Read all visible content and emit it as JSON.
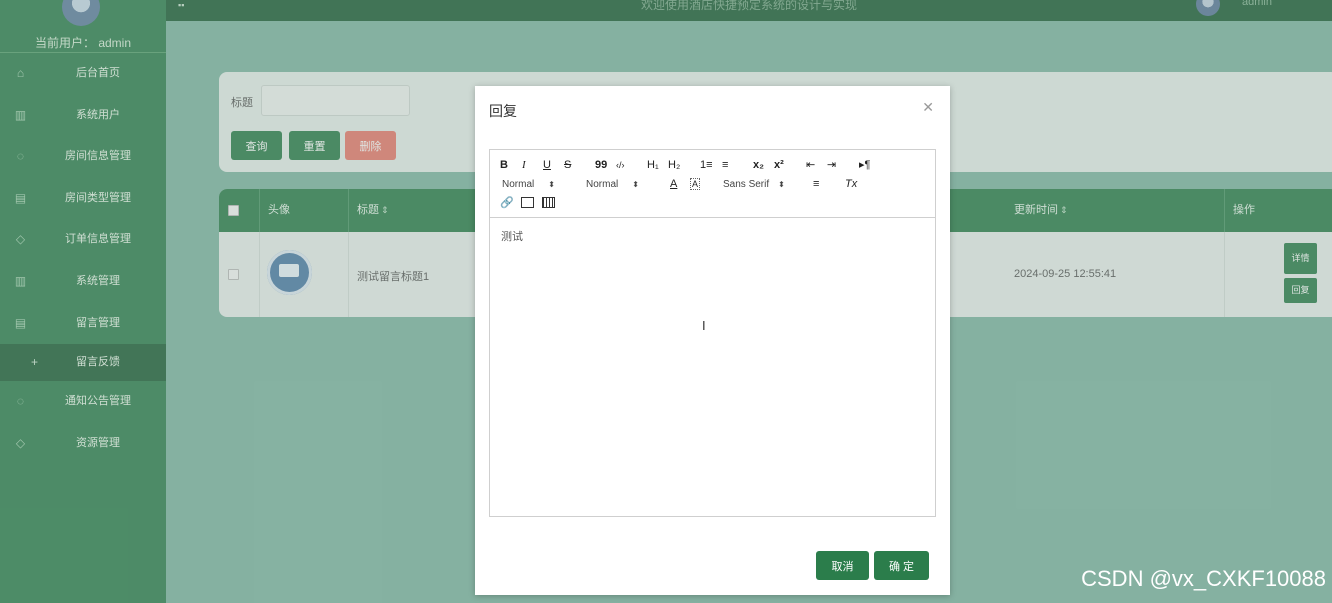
{
  "sidebar": {
    "current_user": "当前用户： admin",
    "items": [
      {
        "label": "后台首页",
        "icon": "home-icon"
      },
      {
        "label": "系统用户",
        "icon": "columns-icon"
      },
      {
        "label": "房间信息管理",
        "icon": "chat-icon"
      },
      {
        "label": "房间类型管理",
        "icon": "document-icon"
      },
      {
        "label": "订单信息管理",
        "icon": "shield-icon"
      },
      {
        "label": "系统管理",
        "icon": "columns-icon"
      },
      {
        "label": "留言管理",
        "icon": "document-icon"
      },
      {
        "label": "留言反馈",
        "icon": "plus-icon"
      },
      {
        "label": "通知公告管理",
        "icon": "chat-icon"
      },
      {
        "label": "资源管理",
        "icon": "shield-icon"
      }
    ]
  },
  "topbar": {
    "title": "欢迎使用酒店快捷预定系统的设计与实现",
    "user": "admin"
  },
  "search": {
    "title_label": "标题",
    "title_value": "",
    "query_label": "查询",
    "reset_label": "重置",
    "delete_label": "删除"
  },
  "table": {
    "headers": {
      "avatar": "头像",
      "title": "标题",
      "updated": "更新时间",
      "actions": "操作"
    },
    "rows": [
      {
        "title": "测试留言标题1",
        "updated": "2024-09-25 12:55:41",
        "detail_label": "详情",
        "reply_label": "回复"
      }
    ]
  },
  "dialog": {
    "title": "回复",
    "toolbar": {
      "bold": "B",
      "italic": "I",
      "underline": "U",
      "strike": "S",
      "blockquote": "99",
      "code": "‹/›",
      "h1": "H₁",
      "h2": "H₂",
      "ordered_list": "1≡",
      "bullet_list": "≡",
      "subscript": "x₂",
      "superscript": "x²",
      "outdent": "⇤",
      "indent": "⇥",
      "direction": "▸¶",
      "size_select": "Normal",
      "header_select": "Normal",
      "color": "A",
      "background": "A",
      "font_select": "Sans Serif",
      "align": "≡",
      "clean": "Tx"
    },
    "content": "测试",
    "cancel_label": "取消",
    "ok_label": "确 定"
  },
  "watermark": "CSDN @vx_CXKF10088"
}
